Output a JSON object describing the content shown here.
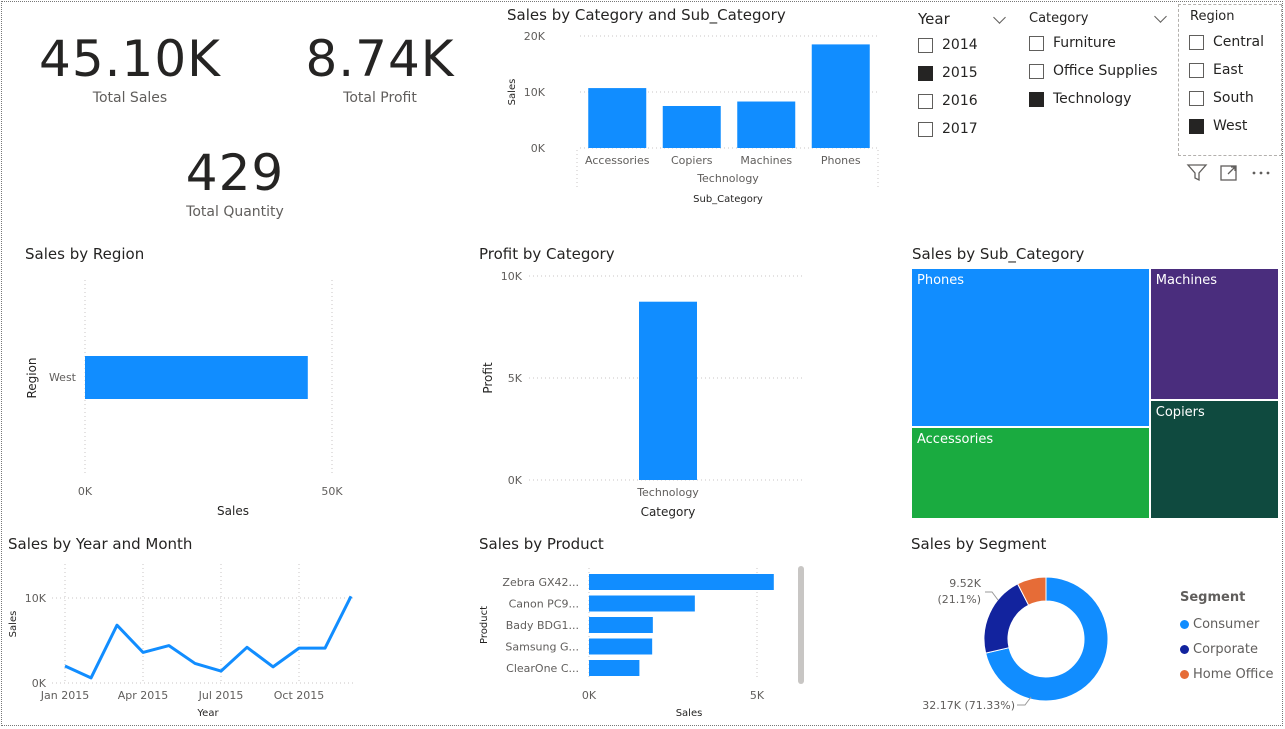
{
  "kpis": {
    "total_sales": {
      "value": "45.10K",
      "label": "Total Sales"
    },
    "total_profit": {
      "value": "8.74K",
      "label": "Total Profit"
    },
    "total_quantity": {
      "value": "429",
      "label": "Total Quantity"
    }
  },
  "slicers": {
    "year": {
      "title": "Year",
      "items": [
        {
          "label": "2014",
          "checked": false
        },
        {
          "label": "2015",
          "checked": true
        },
        {
          "label": "2016",
          "checked": false
        },
        {
          "label": "2017",
          "checked": false
        }
      ]
    },
    "category": {
      "title": "Category",
      "items": [
        {
          "label": "Furniture",
          "checked": false
        },
        {
          "label": "Office Supplies",
          "checked": false
        },
        {
          "label": "Technology",
          "checked": true
        }
      ]
    },
    "region": {
      "title": "Region",
      "items": [
        {
          "label": "Central",
          "checked": false
        },
        {
          "label": "East",
          "checked": false
        },
        {
          "label": "South",
          "checked": false
        },
        {
          "label": "West",
          "checked": true
        }
      ]
    }
  },
  "visual_toolbar": {
    "icons": [
      "filter-icon",
      "focus-mode-icon",
      "more-options-icon"
    ]
  },
  "visuals": {
    "sales_by_cat_sub": {
      "title": "Sales by Category and Sub_Category"
    },
    "sales_by_region": {
      "title": "Sales by Region"
    },
    "profit_by_category": {
      "title": "Profit by Category"
    },
    "sales_by_subcategory": {
      "title": "Sales by Sub_Category"
    },
    "sales_by_year_month": {
      "title": "Sales by Year and Month"
    },
    "sales_by_product": {
      "title": "Sales by Product"
    },
    "sales_by_segment": {
      "title": "Sales by Segment"
    }
  },
  "colors": {
    "accent": "#118dff",
    "consumer": "#118dff",
    "corporate": "#12239e",
    "home_office": "#e66c37",
    "treemap_phones": "#118dff",
    "treemap_machines": "#4a2d7d",
    "treemap_accessories": "#1aab40",
    "treemap_copiers": "#0f4a3f",
    "checked": "#252423"
  },
  "chart_data": [
    {
      "id": "sales_by_cat_sub",
      "type": "bar",
      "title": "Sales by Category and Sub_Category",
      "categories": [
        "Accessories",
        "Copiers",
        "Machines",
        "Phones"
      ],
      "group_label": "Technology",
      "values": [
        10700,
        7500,
        8300,
        18500
      ],
      "xlabel": "Sub_Category",
      "ylabel": "Sales",
      "yticks": [
        "0K",
        "10K",
        "20K"
      ],
      "ylim": [
        0,
        20000
      ],
      "grid": true
    },
    {
      "id": "sales_by_region",
      "type": "bar",
      "orientation": "horizontal",
      "title": "Sales by Region",
      "categories": [
        "West"
      ],
      "values": [
        45100
      ],
      "xlabel": "Sales",
      "ylabel": "Region",
      "xticks": [
        "0K",
        "50K"
      ],
      "xlim": [
        0,
        50000
      ],
      "grid": true
    },
    {
      "id": "profit_by_category",
      "type": "bar",
      "title": "Profit by Category",
      "categories": [
        "Technology"
      ],
      "values": [
        8740
      ],
      "xlabel": "Category",
      "ylabel": "Profit",
      "yticks": [
        "0K",
        "5K",
        "10K"
      ],
      "ylim": [
        0,
        10000
      ],
      "grid": true
    },
    {
      "id": "sales_by_subcategory",
      "type": "treemap",
      "title": "Sales by Sub_Category",
      "categories": [
        "Phones",
        "Machines",
        "Accessories",
        "Copiers"
      ],
      "values": [
        18500,
        8300,
        10700,
        7500
      ]
    },
    {
      "id": "sales_by_year_month",
      "type": "line",
      "title": "Sales by Year and Month",
      "x": [
        "Jan 2015",
        "Feb 2015",
        "Mar 2015",
        "Apr 2015",
        "May 2015",
        "Jun 2015",
        "Jul 2015",
        "Aug 2015",
        "Sep 2015",
        "Oct 2015",
        "Nov 2015",
        "Dec 2015"
      ],
      "values": [
        2000,
        600,
        6800,
        3600,
        4400,
        2300,
        1400,
        4200,
        1900,
        4100,
        4100,
        10200
      ],
      "xticks": [
        "Jan 2015",
        "Apr 2015",
        "Jul 2015",
        "Oct 2015"
      ],
      "yticks": [
        "0K",
        "10K"
      ],
      "ylim": [
        0,
        14000
      ],
      "xlabel": "Year",
      "ylabel": "Sales",
      "grid": true
    },
    {
      "id": "sales_by_product",
      "type": "bar",
      "orientation": "horizontal",
      "title": "Sales by Product",
      "categories": [
        "Zebra GX42...",
        "Canon PC9...",
        "Bady BDG1...",
        "Samsung G...",
        "ClearOne C..."
      ],
      "values": [
        5500,
        3150,
        1900,
        1880,
        1500
      ],
      "xlabel": "Sales",
      "ylabel": "Product",
      "xticks": [
        "0K",
        "5K"
      ],
      "xlim": [
        0,
        6000
      ],
      "grid": true
    },
    {
      "id": "sales_by_segment",
      "type": "pie",
      "variant": "donut",
      "title": "Sales by Segment",
      "legend_title": "Segment",
      "categories": [
        "Consumer",
        "Corporate",
        "Home Office"
      ],
      "values": [
        32170,
        9520,
        3410
      ],
      "data_labels": [
        "32.17K (71.33%)",
        "9.52K (21.1%)"
      ],
      "legend": "right"
    }
  ]
}
